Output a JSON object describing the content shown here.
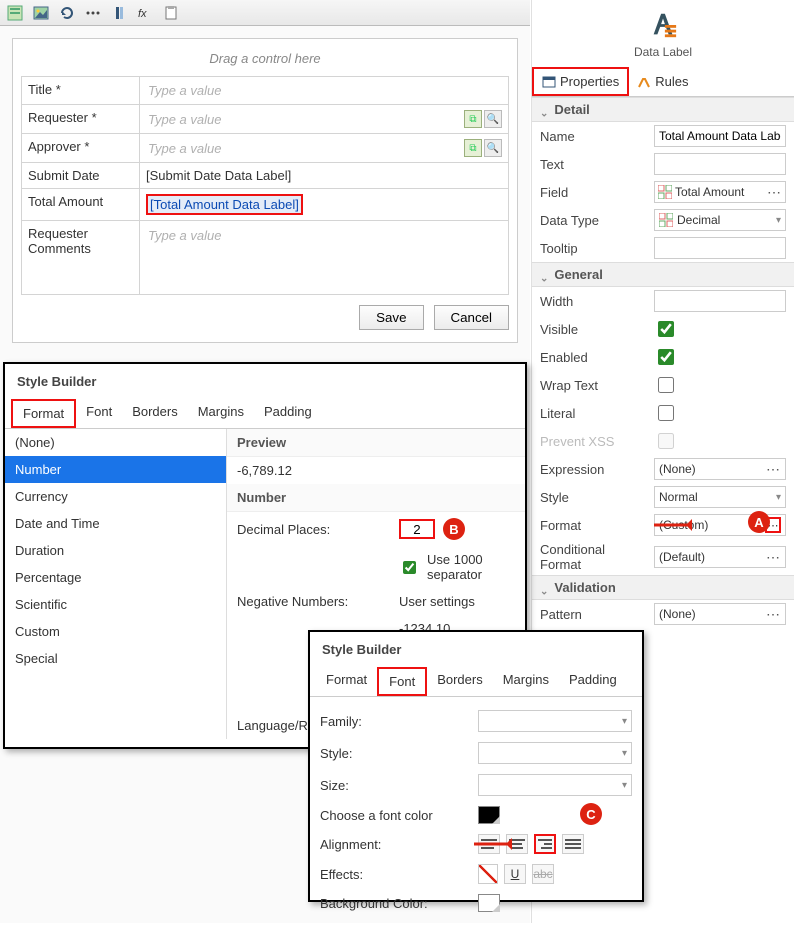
{
  "toolbar_icons": [
    "form-icon",
    "image-icon",
    "refresh-icon",
    "grid-icon",
    "column-icon",
    "fx-icon",
    "clipboard-icon"
  ],
  "form": {
    "drag_hint": "Drag a control here",
    "rows": [
      {
        "label": "Title *",
        "ph": "Type a value"
      },
      {
        "label": "Requester *",
        "ph": "Type a value"
      },
      {
        "label": "Approver *",
        "ph": "Type a value"
      },
      {
        "label": "Submit Date",
        "value": "[Submit Date Data Label]"
      },
      {
        "label": "Total Amount",
        "value": "[Total Amount Data Label]"
      },
      {
        "label": "Requester Comments",
        "ph": "Type a value"
      }
    ],
    "save": "Save",
    "cancel": "Cancel"
  },
  "props": {
    "header": "Data Label",
    "tab_properties": "Properties",
    "tab_rules": "Rules",
    "sect_detail": "Detail",
    "name_label": "Name",
    "name_value": "Total Amount Data Label",
    "text_label": "Text",
    "field_label": "Field",
    "field_value": "Total Amount",
    "datatype_label": "Data Type",
    "datatype_value": "Decimal",
    "tooltip_label": "Tooltip",
    "sect_general": "General",
    "width_label": "Width",
    "visible_label": "Visible",
    "enabled_label": "Enabled",
    "wrap_label": "Wrap Text",
    "literal_label": "Literal",
    "prevent_label": "Prevent XSS",
    "expr_label": "Expression",
    "expr_value": "(None)",
    "style_label": "Style",
    "style_value": "Normal",
    "format_label": "Format",
    "format_value": "(Custom)",
    "cond_label": "Conditional Format",
    "cond_value": "(Default)",
    "sect_validation": "Validation",
    "pattern_label": "Pattern",
    "pattern_value": "(None)"
  },
  "sb1": {
    "title": "Style Builder",
    "tabs": [
      "Format",
      "Font",
      "Borders",
      "Margins",
      "Padding"
    ],
    "list": [
      "(None)",
      "Number",
      "Currency",
      "Date and Time",
      "Duration",
      "Percentage",
      "Scientific",
      "Custom",
      "Special"
    ],
    "preview_label": "Preview",
    "preview_value": "-6,789.12",
    "number_label": "Number",
    "decimal_label": "Decimal Places:",
    "decimal_value": "2",
    "thou_label": "Use 1000 separator",
    "neg_label": "Negative Numbers:",
    "neg_value": "User settings",
    "neg_example": "-1234.10",
    "lang_label": "Language/Reg"
  },
  "sb2": {
    "title": "Style Builder",
    "tabs": [
      "Format",
      "Font",
      "Borders",
      "Margins",
      "Padding"
    ],
    "family_label": "Family:",
    "style_label": "Style:",
    "size_label": "Size:",
    "color_label": "Choose a font color",
    "align_label": "Alignment:",
    "effects_label": "Effects:",
    "bg_label": "Background Color:",
    "underline": "U",
    "strike": "abc"
  },
  "callouts": {
    "A": "A",
    "B": "B",
    "C": "C"
  }
}
